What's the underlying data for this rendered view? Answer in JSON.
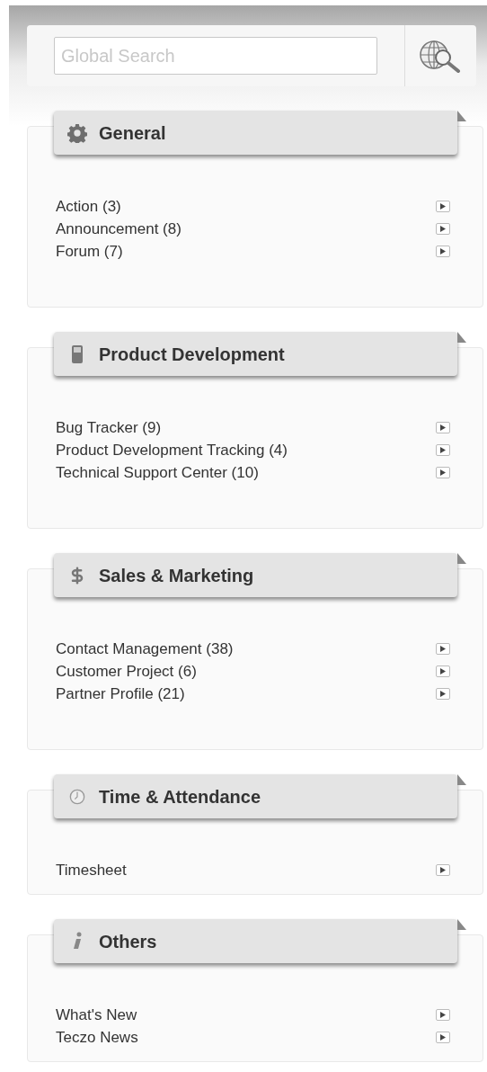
{
  "search": {
    "placeholder": "Global Search"
  },
  "sections": [
    {
      "title": "General",
      "kind": "settings",
      "items": [
        "Action (3)",
        "Announcement (8)",
        "Forum (7)"
      ]
    },
    {
      "title": "Product Development",
      "kind": "device",
      "items": [
        "Bug Tracker (9)",
        "Product Development Tracking (4)",
        "Technical Support Center (10)"
      ]
    },
    {
      "title": "Sales & Marketing",
      "kind": "money",
      "items": [
        "Contact Management (38)",
        "Customer Project (6)",
        "Partner Profile (21)"
      ]
    },
    {
      "title": "Time & Attendance",
      "kind": "time",
      "items": [
        "Timesheet"
      ]
    },
    {
      "title": "Others",
      "kind": "info",
      "items": [
        "What's New",
        "Teczo News"
      ]
    }
  ]
}
